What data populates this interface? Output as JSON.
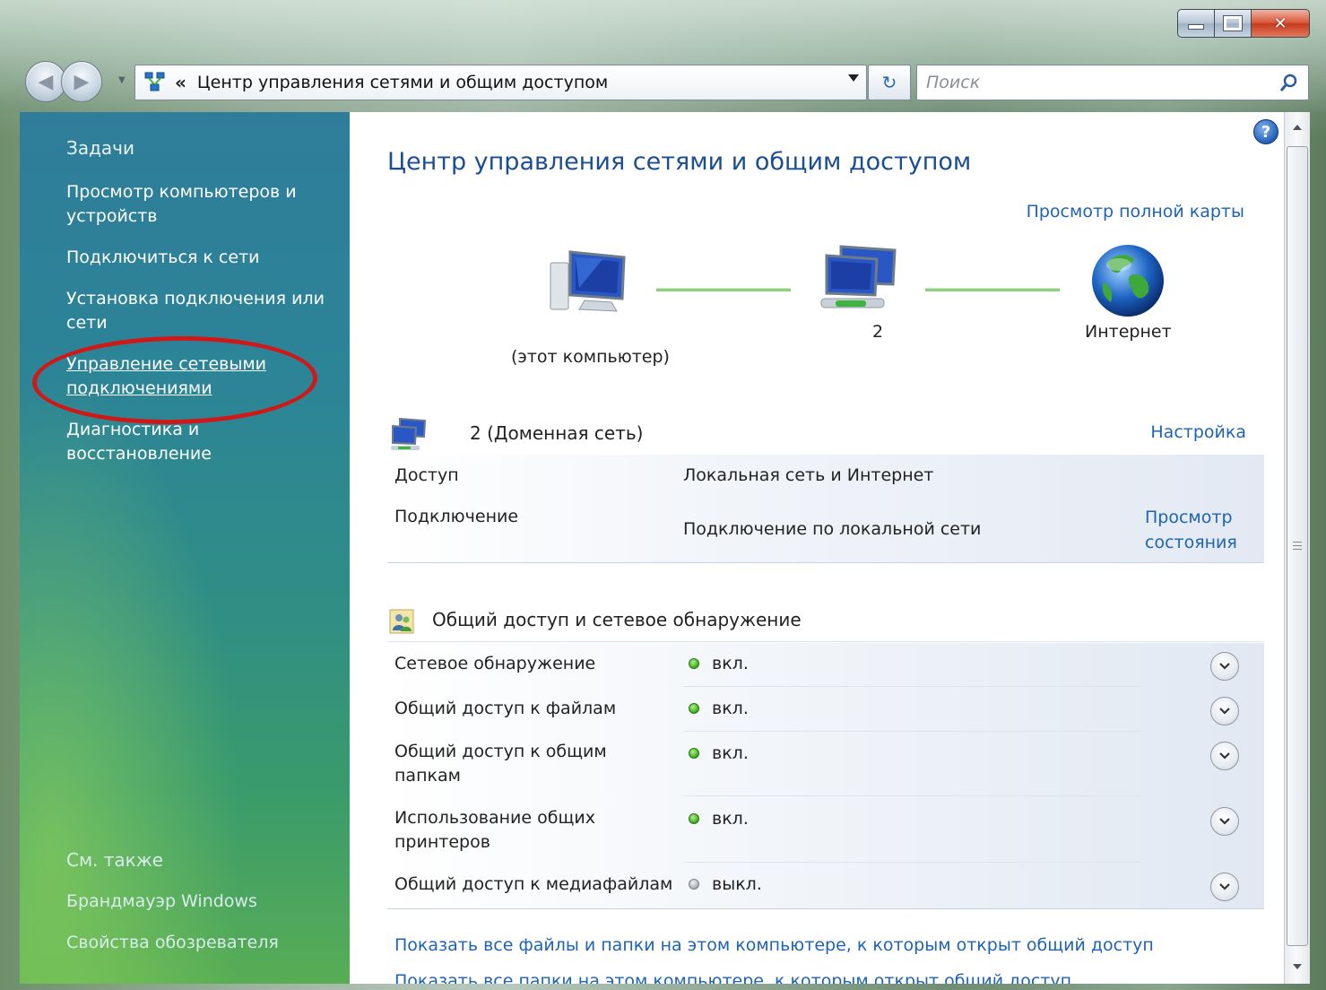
{
  "window": {
    "caption_buttons": [
      "minimize",
      "maximize",
      "close"
    ]
  },
  "address": {
    "chevron": "«",
    "path": "Центр управления сетями и общим доступом",
    "search_placeholder": "Поиск"
  },
  "sidebar": {
    "tasks_heading": "Задачи",
    "items": [
      {
        "label": "Просмотр компьютеров и устройств"
      },
      {
        "label": "Подключиться к сети"
      },
      {
        "label": "Установка подключения или сети"
      },
      {
        "label": "Управление сетевыми подключениями",
        "highlighted": true
      },
      {
        "label": "Диагностика и восстановление"
      }
    ],
    "see_also_heading": "См. также",
    "see_also": [
      {
        "label": "Брандмауэр Windows"
      },
      {
        "label": "Свойства обозревателя"
      }
    ]
  },
  "main": {
    "title": "Центр управления сетями и общим доступом",
    "full_map_link": "Просмотр полной карты",
    "map": {
      "this_computer": "(этот компьютер)",
      "network": "2",
      "internet": "Интернет"
    },
    "network": {
      "name": "2 (Доменная сеть)",
      "configure_link": "Настройка",
      "access_label": "Доступ",
      "access_value": "Локальная сеть и Интернет",
      "connection_label": "Подключение",
      "connection_value": "Подключение по локальной сети",
      "view_status_link": "Просмотр состояния"
    },
    "sharing": {
      "title": "Общий доступ и сетевое обнаружение",
      "rows": [
        {
          "label": "Сетевое обнаружение",
          "status": "вкл.",
          "on": true
        },
        {
          "label": "Общий доступ к файлам",
          "status": "вкл.",
          "on": true
        },
        {
          "label": "Общий доступ к общим папкам",
          "status": "вкл.",
          "on": true
        },
        {
          "label": "Использование общих принтеров",
          "status": "вкл.",
          "on": true
        },
        {
          "label": "Общий доступ к медиафайлам",
          "status": "выкл.",
          "on": false
        }
      ]
    },
    "bottom_links": [
      "Показать все файлы и папки на этом компьютере, к которым открыт общий доступ",
      "Показать все папки на этом компьютере, к которым открыт общий доступ"
    ]
  },
  "colors": {
    "link": "#1e63b4",
    "title": "#1b4e90",
    "status_on": "#38a81b",
    "status_off": "#a7adb3",
    "highlight_ellipse": "#d01818"
  }
}
